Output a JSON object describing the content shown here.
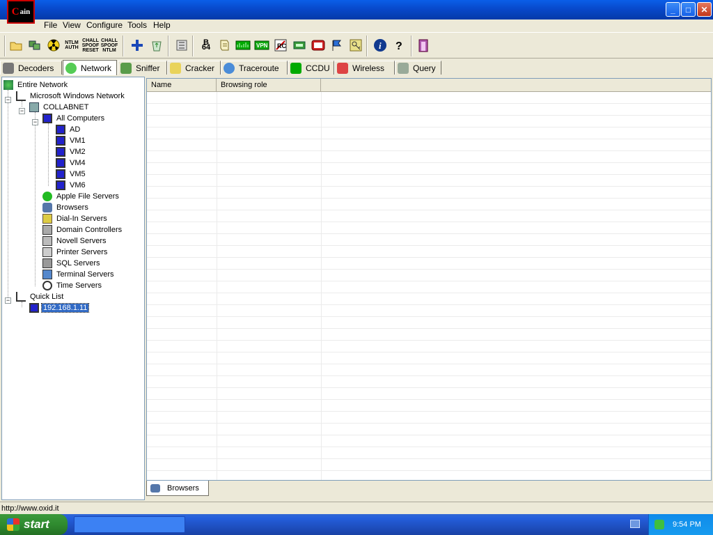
{
  "window": {
    "icon_text": "C",
    "icon_text2": "ain",
    "buttons": {
      "minimize": "_",
      "maximize": "□",
      "close": "✕"
    }
  },
  "menu": [
    "File",
    "View",
    "Configure",
    "Tools",
    "Help"
  ],
  "toolbar": {
    "ntlm_auth": "NTLM AUTH",
    "chall_spoof_reset": "CHALL SPOOF RESET",
    "chall_spoof_ntlm": "CHALL SPOOF NTLM",
    "b64": "B 64"
  },
  "tabs": [
    "Decoders",
    "Network",
    "Sniffer",
    "Cracker",
    "Traceroute",
    "CCDU",
    "Wireless",
    "Query"
  ],
  "tree": {
    "entire_network": "Entire Network",
    "ms_windows_network": "Microsoft Windows Network",
    "collabnet": "COLLABNET",
    "all_computers": "All Computers",
    "computers": [
      "AD",
      "VM1",
      "VM2",
      "VM4",
      "VM5",
      "VM6"
    ],
    "server_groups": [
      "Apple File Servers",
      "Browsers",
      "Dial-In Servers",
      "Domain Controllers",
      "Novell Servers",
      "Printer Servers",
      "SQL Servers",
      "Terminal Servers",
      "Time Servers"
    ],
    "quick_list": "Quick List",
    "quick_list_item": "192.168.1.11"
  },
  "grid": {
    "columns": [
      "Name",
      "Browsing role"
    ]
  },
  "bottom_tab": "Browsers",
  "status": "http://www.oxid.it",
  "taskbar": {
    "start": "start",
    "clock": "9:54 PM"
  },
  "colors": {
    "title_bar": "#0847c8",
    "selection": "#316ac5",
    "taskbar": "#245edb",
    "start_button": "#2f8b2f"
  }
}
